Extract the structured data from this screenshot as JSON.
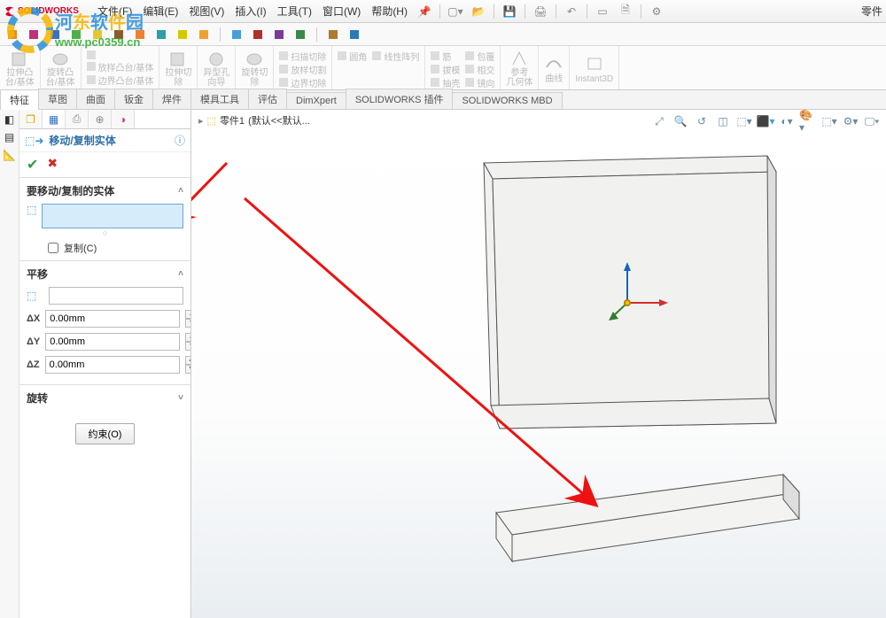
{
  "app": {
    "brand": "SOLIDWORKS"
  },
  "menubar": {
    "file": "文件(F)",
    "edit": "编辑(E)",
    "view": "视图(V)",
    "insert": "插入(I)",
    "tools": "工具(T)",
    "window": "窗口(W)",
    "help": "帮助(H)"
  },
  "doc_title": "零件",
  "ribbon": {
    "g1": "拉伸凸\n台/基体",
    "g2": "旋转凸\n台/基体",
    "sub1a": "放样凸台/基体",
    "sub1b": "边界凸台/基体",
    "g3": "拉伸切\n除",
    "g4": "异型孔\n向导",
    "g5": "旋转切\n除",
    "sub2a": "扫描切除",
    "sub2b": "放样切割",
    "sub2c": "边界切除",
    "sub3a": "圆角",
    "sub3b": "线性阵列",
    "sub4a": "筋",
    "sub4b": "拔模",
    "sub4c": "抽壳",
    "sub4d": "包覆",
    "sub4e": "相交",
    "sub4f": "镜向",
    "g6": "参考\n几何体",
    "g7": "曲线",
    "g8": "Instant3D"
  },
  "doctabs": [
    "特征",
    "草图",
    "曲面",
    "钣金",
    "焊件",
    "模具工具",
    "评估",
    "DimXpert",
    "SOLIDWORKS 插件",
    "SOLIDWORKS MBD"
  ],
  "breadcrumb": {
    "part": "零件1",
    "state": "(默认<<默认..."
  },
  "pm": {
    "title": "移动/复制实体",
    "section_bodies": "要移动/复制的实体",
    "copy": "复制(C)",
    "section_translate": "平移",
    "dx": "ΔX",
    "dy": "ΔY",
    "dz": "ΔZ",
    "dx_val": "0.00mm",
    "dy_val": "0.00mm",
    "dz_val": "0.00mm",
    "section_rotate": "旋转",
    "constrain": "约束(O)"
  },
  "watermark_url": "www.pc0359.cn"
}
